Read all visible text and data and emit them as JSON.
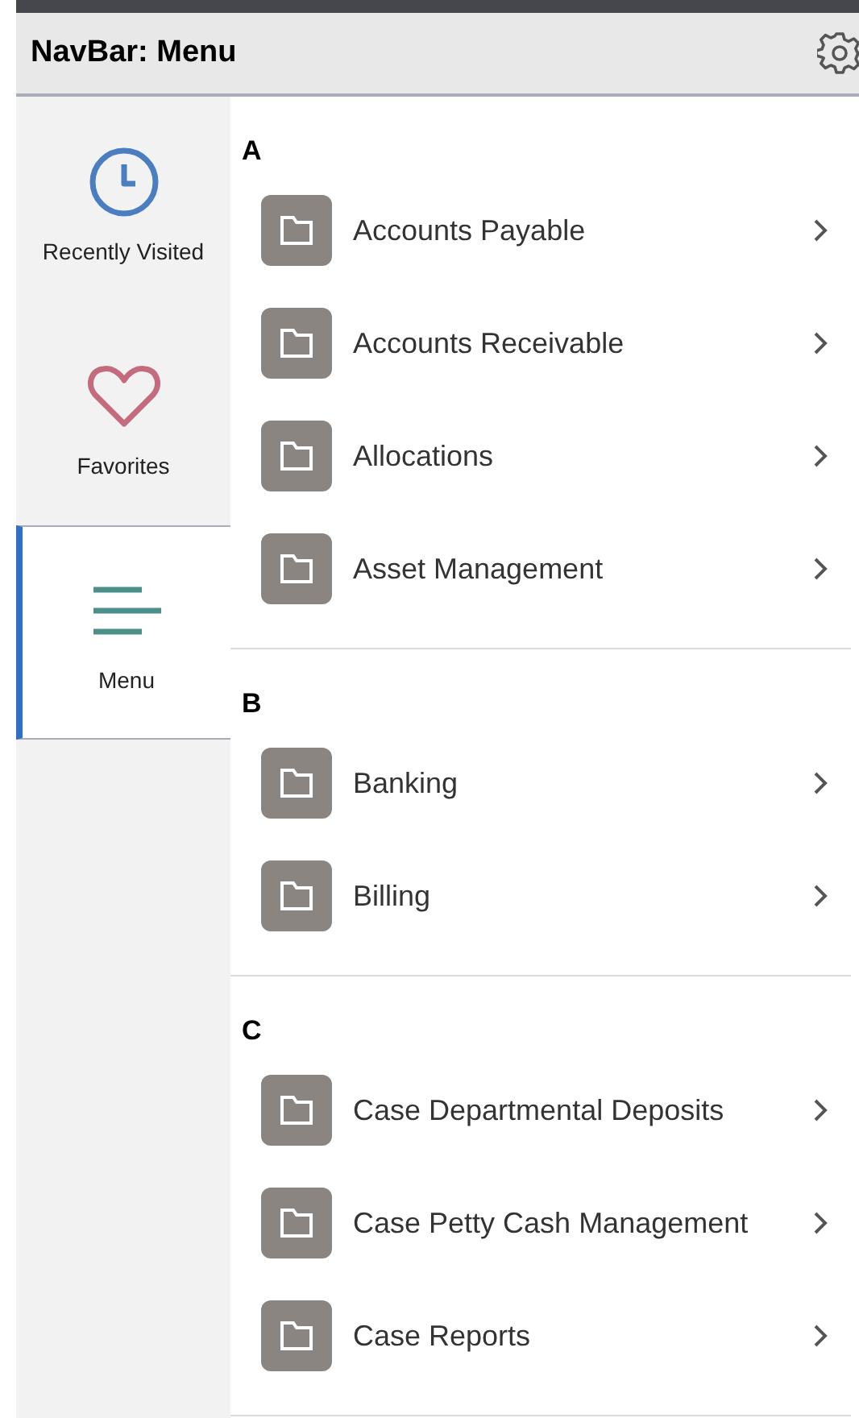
{
  "header": {
    "title": "NavBar: Menu"
  },
  "sidebar": {
    "items": [
      {
        "label": "Recently Visited",
        "selected": false
      },
      {
        "label": "Favorites",
        "selected": false
      },
      {
        "label": "Menu",
        "selected": true
      }
    ]
  },
  "sections": [
    {
      "letter": "A",
      "items": [
        {
          "label": "Accounts Payable"
        },
        {
          "label": "Accounts Receivable"
        },
        {
          "label": "Allocations"
        },
        {
          "label": "Asset Management"
        }
      ]
    },
    {
      "letter": "B",
      "items": [
        {
          "label": "Banking"
        },
        {
          "label": "Billing"
        }
      ]
    },
    {
      "letter": "C",
      "items": [
        {
          "label": "Case Departmental Deposits"
        },
        {
          "label": "Case Petty Cash Management"
        },
        {
          "label": "Case Reports"
        }
      ]
    }
  ]
}
